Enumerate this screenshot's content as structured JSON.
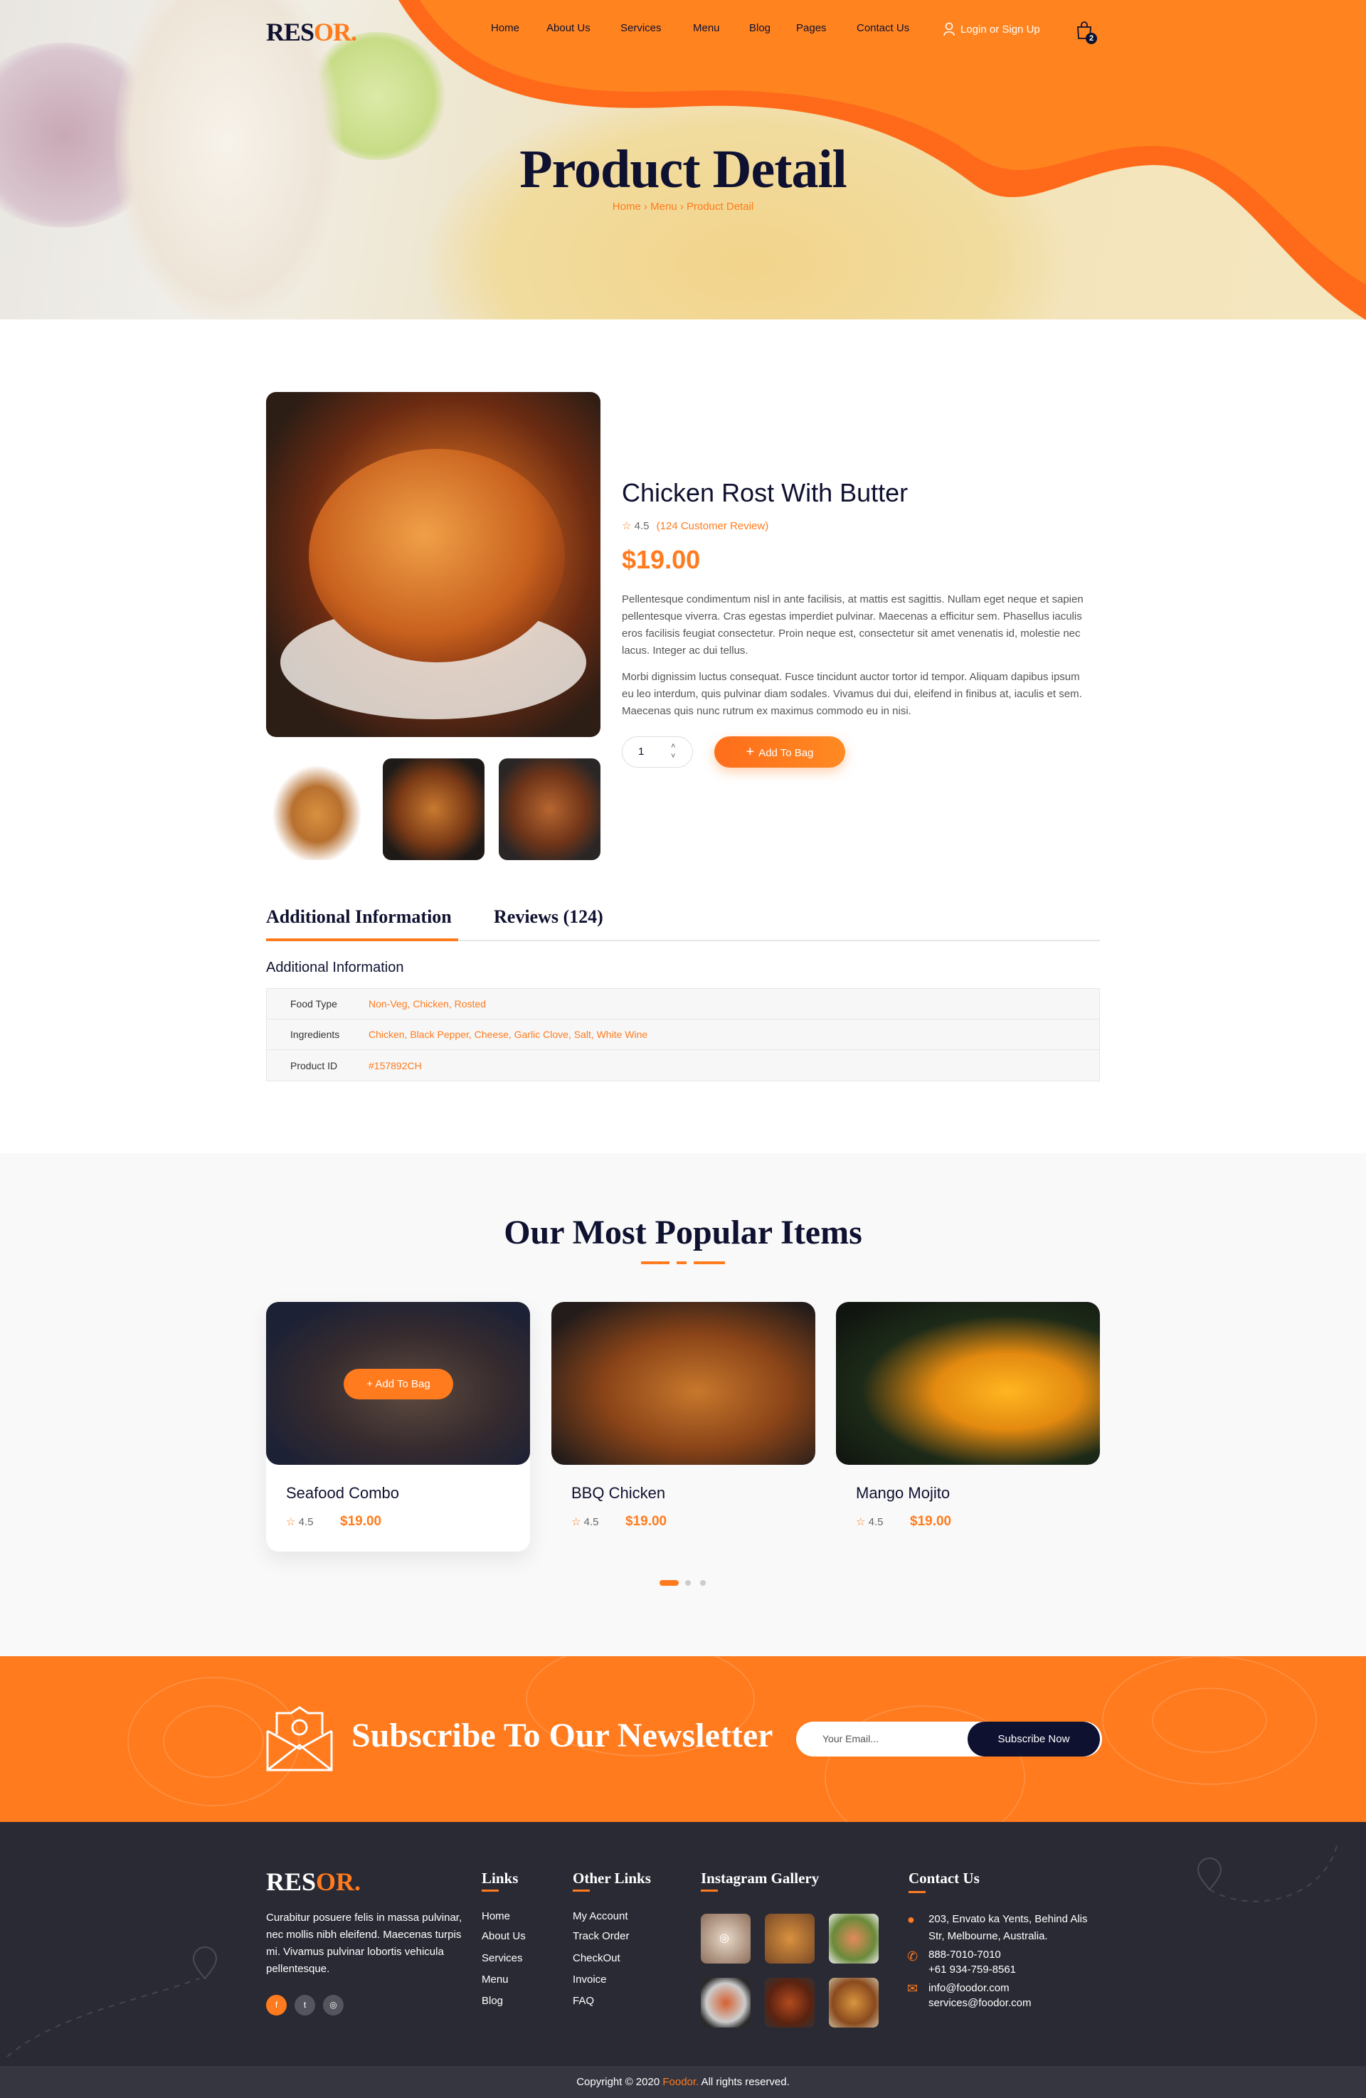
{
  "colors": {
    "accent": "#ff7b1e",
    "navy": "#0f1130",
    "footer": "#2a2a35"
  },
  "header": {
    "logo": {
      "main": "RES",
      "accent": "OR."
    },
    "nav": [
      "Home",
      "About Us",
      "Services",
      "Menu",
      "Blog",
      "Pages",
      "Contact Us"
    ],
    "login": "Login or Sign Up",
    "cart_count": "2"
  },
  "hero": {
    "title": "Product Detail",
    "breadcrumb": [
      "Home",
      "Menu",
      "Product Detail"
    ]
  },
  "product": {
    "title": "Chicken Rost With Butter",
    "rating": "4.5",
    "reviews": "(124 Customer Review)",
    "price": "$19.00",
    "desc1": "Pellentesque condimentum nisl in ante facilisis, at mattis est sagittis. Nullam eget neque et sapien pellentesque viverra. Cras egestas imperdiet pulvinar. Maecenas a efficitur sem. Phasellus iaculis eros facilisis feugiat consectetur. Proin neque est, consectetur sit amet venenatis id, molestie nec lacus. Integer ac dui tellus.",
    "desc2": "Morbi dignissim luctus consequat. Fusce tincidunt auctor tortor id tempor. Aliquam dapibus ipsum eu leo interdum, quis pulvinar diam sodales. Vivamus dui dui, eleifend in finibus at, iaculis et sem. Maecenas quis nunc rutrum ex maximus commodo eu in nisi.",
    "quantity": "1",
    "add_label": "Add To Bag"
  },
  "tabs": {
    "items": [
      "Additional Information",
      "Reviews (124)"
    ],
    "active": 0
  },
  "additional": {
    "heading": "Additional Information",
    "rows": [
      {
        "k": "Food Type",
        "v": "Non-Veg, Chicken, Rosted"
      },
      {
        "k": "Ingredients",
        "v": "Chicken, Black Pepper, Cheese, Garlic Clove, Salt, White Wine"
      },
      {
        "k": "Product ID",
        "v": "#157892CH"
      }
    ]
  },
  "popular": {
    "title": "Our Most Popular Items",
    "hover_button": "Add To Bag",
    "items": [
      {
        "name": "Seafood Combo",
        "rating": "4.5",
        "price": "$19.00"
      },
      {
        "name": "BBQ Chicken",
        "rating": "4.5",
        "price": "$19.00"
      },
      {
        "name": "Mango Mojito",
        "rating": "4.5",
        "price": "$19.00"
      }
    ],
    "active_page": 1,
    "pages": 3
  },
  "newsletter": {
    "title": "Subscribe To Our Newsletter",
    "placeholder": "Your Email...",
    "button": "Subscribe Now"
  },
  "footer": {
    "about": "Curabitur posuere felis in massa pulvinar, nec mollis nibh eleifend. Maecenas turpis mi. Vivamus pulvinar lobortis vehicula pellentesque.",
    "links_title": "Links",
    "links": [
      "Home",
      "About Us",
      "Services",
      "Menu",
      "Blog"
    ],
    "other_title": "Other Links",
    "other": [
      "My Account",
      "Track Order",
      "CheckOut",
      "Invoice",
      "FAQ"
    ],
    "gallery_title": "Instagram Gallery",
    "contact_title": "Contact Us",
    "address": [
      "203, Envato ka Yents, Behind Alis",
      "Str, Melbourne, Australia."
    ],
    "phones": [
      "888-7010-7010",
      "+61 934-759-8561"
    ],
    "emails": [
      "info@foodor.com",
      "services@foodor.com"
    ],
    "copyright": {
      "pre": "Copyright © 2020 ",
      "brand": "Foodor.",
      "post": " All rights reserved."
    }
  }
}
